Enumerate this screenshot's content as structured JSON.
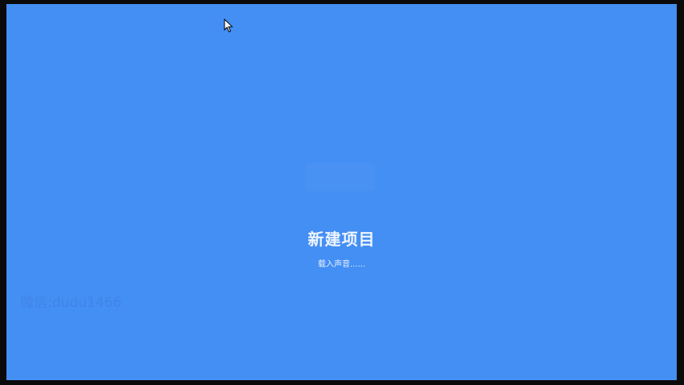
{
  "splash": {
    "title": "新建项目",
    "status": "载入声音......"
  },
  "watermark": {
    "text": "微信:dudu1466"
  },
  "icons": {
    "cursor": "mouse-pointer-icon"
  },
  "colors": {
    "background": "#438ff4",
    "text": "#eef4ff",
    "frame": "#0a0a0a"
  }
}
